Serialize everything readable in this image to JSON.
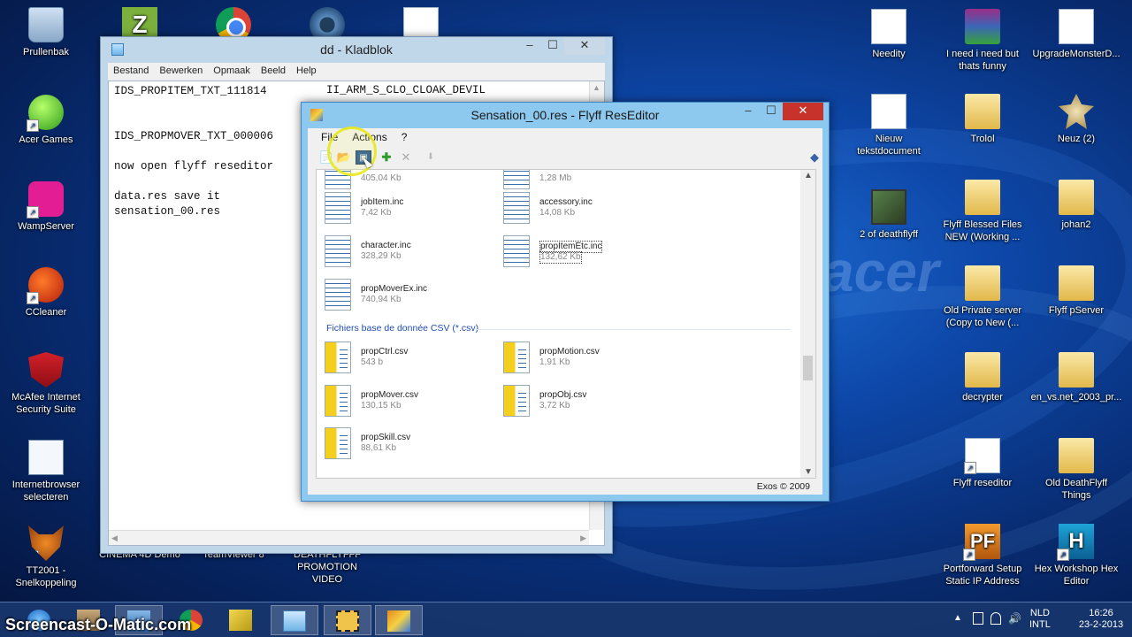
{
  "desktop": {
    "icons": [
      {
        "label": "Prullenbak"
      },
      {
        "label": "Acer Games"
      },
      {
        "label": "WampServer"
      },
      {
        "label": "CCleaner"
      },
      {
        "label": "McAfee Internet Security Suite"
      },
      {
        "label": "Internetbrowser selecteren"
      },
      {
        "label": "TT2001 - Snelkoppeling"
      },
      {
        "label": "CINEMA 4D Demo"
      },
      {
        "label": "TeamViewer 8"
      },
      {
        "label": "DEATHFLYFFF PROMOTION VIDEO"
      },
      {
        "label": "Needity"
      },
      {
        "label": "I need i need but thats funny"
      },
      {
        "label": "UpgradeMonsterD..."
      },
      {
        "label": "Trolol"
      },
      {
        "label": "Neuz (2)"
      },
      {
        "label": "Nieuw tekstdocument"
      },
      {
        "label": "2 of deathflyff"
      },
      {
        "label": "Flyff Blessed Files NEW (Working ..."
      },
      {
        "label": "johan2"
      },
      {
        "label": "Old Private server (Copy to New (..."
      },
      {
        "label": "Flyff pServer"
      },
      {
        "label": "decrypter"
      },
      {
        "label": "en_vs.net_2003_pr..."
      },
      {
        "label": "Flyff reseditor"
      },
      {
        "label": "Old DeathFlyff Things"
      },
      {
        "label": "Portforward Setup Static IP Address"
      },
      {
        "label": "Hex Workshop Hex Editor"
      }
    ],
    "brand_watermark": "acer"
  },
  "notepad": {
    "title": "dd - Kladblok",
    "menu": [
      "Bestand",
      "Bewerken",
      "Opmaak",
      "Beeld",
      "Help"
    ],
    "content": "IDS_PROPITEM_TXT_111814\n\n\nIDS_PROPMOVER_TXT_000006\n\nnow open flyff reseditor\n\ndata.res save it\nsensation_00.res",
    "col2": "II_ARM_S_CLO_CLOAK_DEVIL"
  },
  "reseditor": {
    "title": "Sensation_00.res - Flyff ResEditor",
    "menu": [
      "File",
      "Actions",
      "?"
    ],
    "toolbar_icons": [
      "new-icon",
      "open-icon",
      "save-icon",
      "add-icon",
      "delete-icon",
      "move-icon",
      "layers-icon"
    ],
    "files_inc": [
      {
        "name": "",
        "size": "405,04 Kb"
      },
      {
        "name": "",
        "size": "1,28 Mb"
      },
      {
        "name": "jobItem.inc",
        "size": "7,42 Kb"
      },
      {
        "name": "accessory.inc",
        "size": "14,08 Kb"
      },
      {
        "name": "character.inc",
        "size": "328,29 Kb"
      },
      {
        "name": "propItemEtc.inc",
        "size": "132,62 Kb"
      },
      {
        "name": "propMoverEx.inc",
        "size": "740,94 Kb"
      }
    ],
    "group_csv": "Fichiers base de donnée CSV (*.csv)",
    "files_csv": [
      {
        "name": "propCtrl.csv",
        "size": "543 b"
      },
      {
        "name": "propMotion.csv",
        "size": "1,91 Kb"
      },
      {
        "name": "propMover.csv",
        "size": "130,15 Kb"
      },
      {
        "name": "propObj.csv",
        "size": "3,72 Kb"
      },
      {
        "name": "propSkill.csv",
        "size": "88,61 Kb"
      }
    ],
    "status": "Exos © 2009"
  },
  "taskbar": {
    "watermark": "Screencast-O-Matic.com",
    "lang_top": "NLD",
    "lang_bottom": "INTL",
    "time": "16:26",
    "date": "23-2-2013"
  }
}
